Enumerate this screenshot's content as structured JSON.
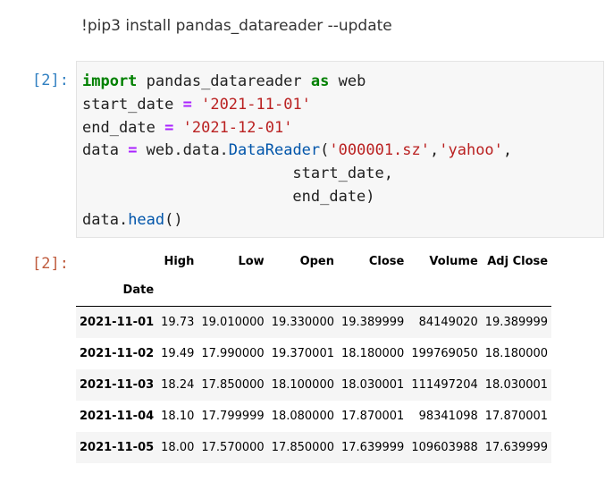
{
  "markdown_cell": {
    "text": "!pip3 install pandas_datareader --update"
  },
  "code_cell": {
    "in_prompt": "[2]:",
    "out_prompt": "[2]:",
    "code": {
      "import_kw": "import",
      "module": " pandas_datareader ",
      "as_kw": "as",
      "alias": " web",
      "start_var": "start_date ",
      "eq": "=",
      "start_val": "'2021-11-01'",
      "end_var": "end_date ",
      "end_val": "'2021-12-01'",
      "data_var": "data ",
      "call_prefix": " web.data.",
      "call_fn": "DataReader",
      "open_paren": "(",
      "arg_ticker": "'000001.sz'",
      "comma": ",",
      "arg_source": "'yahoo'",
      "arg_start": "start_date,",
      "arg_end": "end_date)",
      "head_prefix": "data.",
      "head_fn": "head",
      "head_suffix": "()"
    }
  },
  "dataframe": {
    "index_name": "Date",
    "columns": [
      "High",
      "Low",
      "Open",
      "Close",
      "Volume",
      "Adj Close"
    ],
    "rows": [
      {
        "date": "2021-11-01",
        "values": [
          "19.73",
          "19.010000",
          "19.330000",
          "19.389999",
          "84149020",
          "19.389999"
        ]
      },
      {
        "date": "2021-11-02",
        "values": [
          "19.49",
          "17.990000",
          "19.370001",
          "18.180000",
          "199769050",
          "18.180000"
        ]
      },
      {
        "date": "2021-11-03",
        "values": [
          "18.24",
          "17.850000",
          "18.100000",
          "18.030001",
          "111497204",
          "18.030001"
        ]
      },
      {
        "date": "2021-11-04",
        "values": [
          "18.10",
          "17.799999",
          "18.080000",
          "17.870001",
          "98341098",
          "17.870001"
        ]
      },
      {
        "date": "2021-11-05",
        "values": [
          "18.00",
          "17.570000",
          "17.850000",
          "17.639999",
          "109603988",
          "17.639999"
        ]
      }
    ]
  }
}
